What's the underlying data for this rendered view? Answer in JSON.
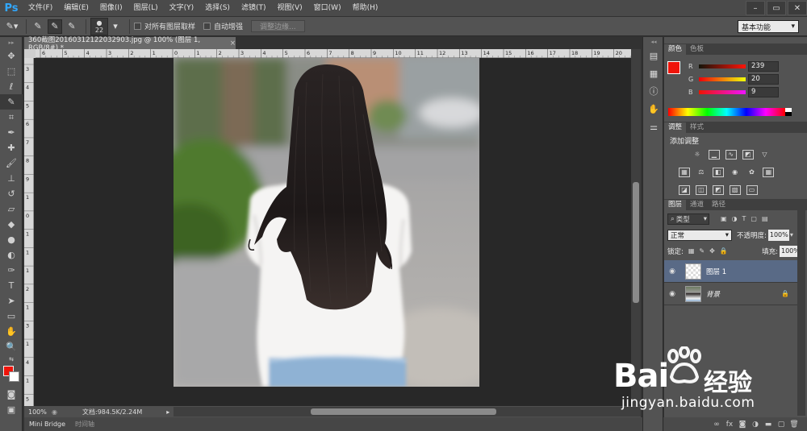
{
  "app": {
    "logo": "Ps"
  },
  "menu": [
    "文件(F)",
    "编辑(E)",
    "图像(I)",
    "图层(L)",
    "文字(Y)",
    "选择(S)",
    "滤镜(T)",
    "视图(V)",
    "窗口(W)",
    "帮助(H)"
  ],
  "options": {
    "brush_size": "22",
    "sample_all_layers": "对所有图层取样",
    "auto_enhance": "自动增强",
    "refine_edge": "调整边缘...",
    "workspace": "基本功能"
  },
  "document": {
    "tab_title": "360截图20160312122032903.jpg @ 100% (图层 1, RGB/8#) *",
    "zoom": "100%",
    "doc_size": "文档:984.5K/2.24M",
    "ruler_top": [
      "6",
      "5",
      "4",
      "3",
      "2",
      "1",
      "0",
      "1",
      "2",
      "3",
      "4",
      "5",
      "6",
      "7",
      "8",
      "9",
      "10",
      "11",
      "12",
      "13",
      "14",
      "15",
      "16",
      "17",
      "18",
      "19",
      "20"
    ],
    "ruler_left": [
      "3",
      "4",
      "5",
      "6",
      "7",
      "8",
      "9",
      "1",
      "0",
      "1",
      "1",
      "1",
      "2",
      "1",
      "3",
      "1",
      "4",
      "1",
      "5"
    ]
  },
  "bottom_tabs": [
    "Mini Bridge",
    "时间轴"
  ],
  "color_panel": {
    "tabs": [
      "颜色",
      "色板"
    ],
    "r": "239",
    "g": "20",
    "b": "9",
    "labels": [
      "R",
      "G",
      "B"
    ],
    "fg_color": "#ef1409",
    "bg_color": "#ffffff"
  },
  "adjust_panel": {
    "tabs": [
      "调整",
      "样式"
    ],
    "title": "添加调整"
  },
  "layers_panel": {
    "tabs": [
      "图层",
      "通道",
      "路径"
    ],
    "filter": "类型",
    "blend": "正常",
    "opacity_label": "不透明度:",
    "opacity": "100%",
    "lock_label": "锁定:",
    "fill_label": "填充:",
    "fill": "100%",
    "layers": [
      {
        "name": "图层 1",
        "selected": true
      },
      {
        "name": "背景",
        "selected": false
      }
    ]
  },
  "watermark": {
    "brand": "Bai",
    "brand2": "经验",
    "url": "jingyan.baidu.com"
  }
}
